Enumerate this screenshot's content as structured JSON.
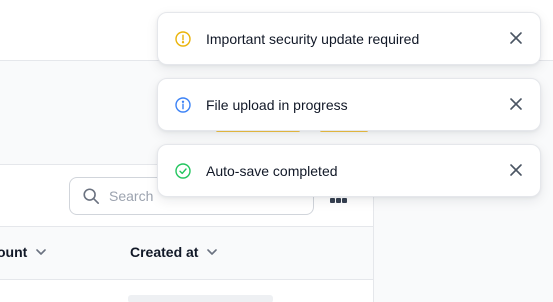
{
  "search": {
    "placeholder": "Search"
  },
  "table": {
    "columns": [
      {
        "label": "ount"
      },
      {
        "label": "Created at"
      }
    ]
  },
  "toasts": [
    {
      "type": "warning",
      "message": "Important security update required",
      "icon": "warning-icon",
      "color": "#eab308"
    },
    {
      "type": "info",
      "message": "File upload in progress",
      "icon": "info-icon",
      "color": "#3b82f6"
    },
    {
      "type": "success",
      "message": "Auto-save completed",
      "icon": "check-circle-icon",
      "color": "#22c55e"
    }
  ],
  "colors": {
    "accent": "#f5c542",
    "border": "#e5e7eb",
    "text": "#111827"
  }
}
